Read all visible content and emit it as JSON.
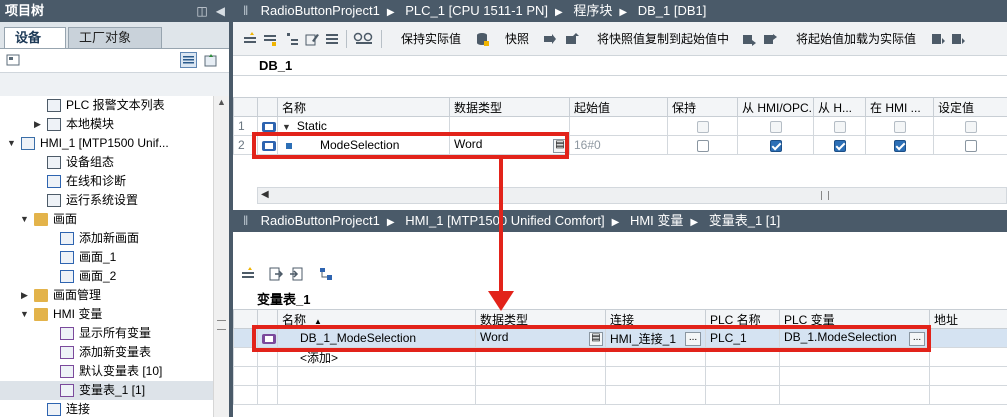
{
  "left_panel": {
    "title": "项目树",
    "tabs": [
      "设备",
      "工厂对象"
    ],
    "tree": [
      {
        "label": "PLC 报警文本列表",
        "indent": 3,
        "arrow": "",
        "icon": "list-icon",
        "selected": false
      },
      {
        "label": "本地模块",
        "indent": 3,
        "arrow": "▶",
        "icon": "module-icon",
        "selected": false
      },
      {
        "label": "HMI_1 [MTP1500 Unif...",
        "indent": 1,
        "arrow": "▼",
        "icon": "hmi-device-icon",
        "selected": false
      },
      {
        "label": "设备组态",
        "indent": 3,
        "arrow": "",
        "icon": "device-config-icon",
        "selected": false
      },
      {
        "label": "在线和诊断",
        "indent": 3,
        "arrow": "",
        "icon": "online-diagnostics-icon",
        "selected": false
      },
      {
        "label": "运行系统设置",
        "indent": 3,
        "arrow": "",
        "icon": "runtime-settings-icon",
        "selected": false
      },
      {
        "label": "画面",
        "indent": 2,
        "arrow": "▼",
        "icon": "folder-icon",
        "selected": false
      },
      {
        "label": "添加新画面",
        "indent": 4,
        "arrow": "",
        "icon": "add-screen-icon",
        "selected": false
      },
      {
        "label": "画面_1",
        "indent": 4,
        "arrow": "",
        "icon": "screen-icon",
        "selected": false
      },
      {
        "label": "画面_2",
        "indent": 4,
        "arrow": "",
        "icon": "screen-icon",
        "selected": false
      },
      {
        "label": "画面管理",
        "indent": 2,
        "arrow": "▶",
        "icon": "folder-icon",
        "selected": false
      },
      {
        "label": "HMI 变量",
        "indent": 2,
        "arrow": "▼",
        "icon": "folder-icon",
        "selected": false
      },
      {
        "label": "显示所有变量",
        "indent": 4,
        "arrow": "",
        "icon": "show-tags-icon",
        "selected": false
      },
      {
        "label": "添加新变量表",
        "indent": 4,
        "arrow": "",
        "icon": "add-tag-table-icon",
        "selected": false
      },
      {
        "label": "默认变量表 [10]",
        "indent": 4,
        "arrow": "",
        "icon": "tag-table-icon",
        "selected": false
      },
      {
        "label": "变量表_1 [1]",
        "indent": 4,
        "arrow": "",
        "icon": "tag-table-icon",
        "selected": true
      },
      {
        "label": "连接",
        "indent": 3,
        "arrow": "",
        "icon": "connection-icon",
        "selected": false
      }
    ]
  },
  "db_editor": {
    "breadcrumb": [
      "RadioButtonProject1",
      "PLC_1 [CPU 1511-1 PN]",
      "程序块",
      "DB_1 [DB1]"
    ],
    "toolbar": {
      "keep_actual": "保持实际值",
      "snapshot": "快照",
      "copy_snapshot": "将快照值复制到起始值中",
      "load_start": "将起始值加载为实际值"
    },
    "db_name": "DB_1",
    "columns": [
      "名称",
      "数据类型",
      "起始值",
      "保持",
      "从 HMI/OPC...",
      "从 H...",
      "在 HMI ...",
      "设定值"
    ],
    "rows": [
      {
        "num": "1",
        "name": "Static",
        "type": "",
        "start": "",
        "retain": null,
        "hmi_access": null,
        "hmi_write": null,
        "hmi_visible": null,
        "setpoint": null,
        "expanded": true
      },
      {
        "num": "2",
        "name": "ModeSelection",
        "type": "Word",
        "start": "16#0",
        "retain": false,
        "hmi_access": true,
        "hmi_write": true,
        "hmi_visible": true,
        "setpoint": false,
        "expanded": false
      }
    ]
  },
  "hmi_tags": {
    "breadcrumb": [
      "RadioButtonProject1",
      "HMI_1 [MTP1500 Unified Comfort]",
      "HMI 变量",
      "变量表_1 [1]"
    ],
    "table_name": "变量表_1",
    "columns": [
      "名称",
      "数据类型",
      "连接",
      "PLC 名称",
      "PLC 变量",
      "地址"
    ],
    "rows": [
      {
        "name": "DB_1_ModeSelection",
        "type": "Word",
        "connection": "HMI_连接_1",
        "plc_name": "PLC_1",
        "plc_tag": "DB_1.ModeSelection",
        "address": ""
      }
    ],
    "add_row": "<添加>"
  },
  "colors": {
    "title_bar": "#4a5a69",
    "annotation_red": "#e2231a",
    "selection_blue": "#2c6fb6"
  }
}
